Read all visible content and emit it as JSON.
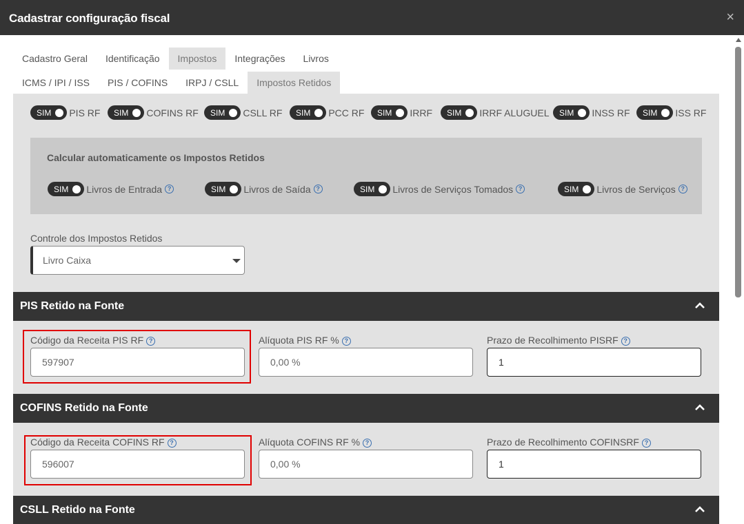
{
  "window": {
    "title": "Cadastrar configuração fiscal",
    "close_symbol": "×"
  },
  "tabs_row1": [
    {
      "label": "Cadastro Geral"
    },
    {
      "label": "Identificação"
    },
    {
      "label": "Impostos"
    },
    {
      "label": "Integrações"
    },
    {
      "label": "Livros"
    }
  ],
  "tabs_row2": [
    {
      "label": "ICMS / IPI / ISS"
    },
    {
      "label": "PIS / COFINS"
    },
    {
      "label": "IRPJ / CSLL"
    },
    {
      "label": "Impostos Retidos"
    }
  ],
  "toggles": [
    {
      "state": "SIM",
      "label": "PIS RF"
    },
    {
      "state": "SIM",
      "label": "COFINS RF"
    },
    {
      "state": "SIM",
      "label": "CSLL RF"
    },
    {
      "state": "SIM",
      "label": "PCC RF"
    },
    {
      "state": "SIM",
      "label": "IRRF"
    },
    {
      "state": "SIM",
      "label": "IRRF ALUGUEL"
    },
    {
      "state": "SIM",
      "label": "INSS RF"
    },
    {
      "state": "SIM",
      "label": "ISS RF"
    }
  ],
  "auto_calc": {
    "title": "Calcular automaticamente os Impostos Retidos",
    "items": [
      {
        "state": "SIM",
        "label": "Livros de Entrada"
      },
      {
        "state": "SIM",
        "label": "Livros de Saída"
      },
      {
        "state": "SIM",
        "label": "Livros de Serviços Tomados"
      },
      {
        "state": "SIM",
        "label": "Livros de Serviços"
      }
    ]
  },
  "control": {
    "label": "Controle dos Impostos Retidos",
    "value": "Livro Caixa"
  },
  "sections": {
    "pis": {
      "title": "PIS Retido na Fonte",
      "codigo_label": "Código da Receita PIS RF",
      "codigo_value": "597907",
      "aliquota_label": "Alíquota PIS RF %",
      "aliquota_value": "0,00 %",
      "prazo_label": "Prazo de Recolhimento PISRF",
      "prazo_value": "1"
    },
    "cofins": {
      "title": "COFINS Retido na Fonte",
      "codigo_label": "Código da Receita COFINS RF",
      "codigo_value": "596007",
      "aliquota_label": "Alíquota COFINS RF %",
      "aliquota_value": "0,00 %",
      "prazo_label": "Prazo de Recolhimento COFINSRF",
      "prazo_value": "1"
    },
    "csll": {
      "title": "CSLL Retido na Fonte"
    }
  },
  "help_symbol": "?",
  "icons": {
    "close": "close-icon",
    "chevron": "chevron-up-icon",
    "help": "help-icon",
    "dropdown": "caret-down-icon"
  },
  "colors": {
    "header": "#343434",
    "panel": "#e2e2e2",
    "highlight": "#e00000",
    "help": "#3a6fb0"
  }
}
